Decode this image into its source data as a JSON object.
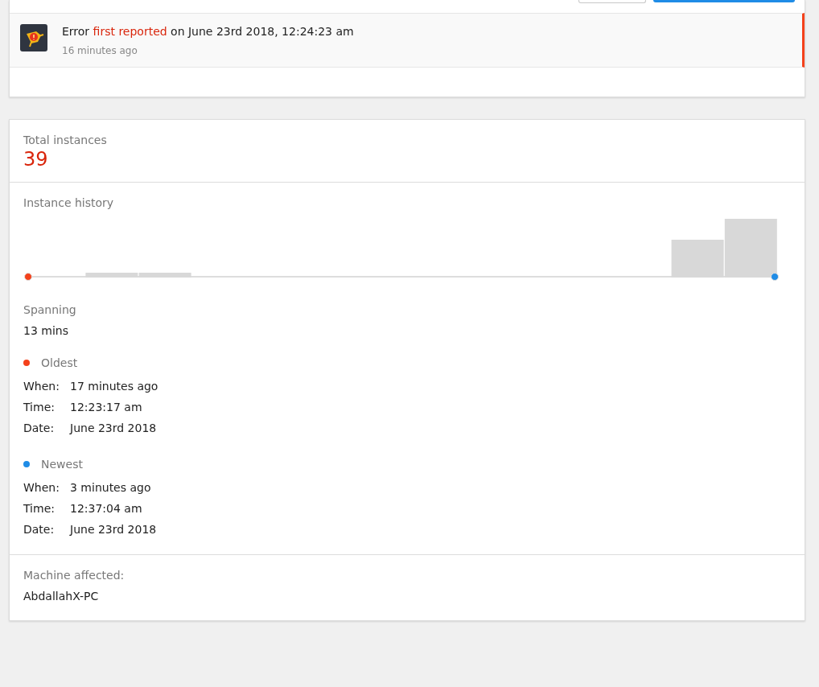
{
  "event": {
    "message_start": "Error",
    "message_highlight": "first reported",
    "message_end": "on June 23rd 2018, 12:24:23 am",
    "time_ago": "16 minutes ago"
  },
  "total": {
    "label": "Total instances",
    "value": "39"
  },
  "history": {
    "label": "Instance history"
  },
  "spanning": {
    "label": "Spanning",
    "value": "13 mins"
  },
  "endpoints": [
    {
      "title": "Oldest",
      "color": "#f4411b",
      "fields": [
        {
          "label": "When:",
          "value": "17 minutes ago"
        },
        {
          "label": "Time:",
          "value": "12:23:17 am"
        },
        {
          "label": "Date:",
          "value": "June 23rd 2018"
        }
      ]
    },
    {
      "title": "Newest",
      "color": "#1f8ce6",
      "fields": [
        {
          "label": "When:",
          "value": "3 minutes ago"
        },
        {
          "label": "Time:",
          "value": "12:37:04 am"
        },
        {
          "label": "Date:",
          "value": "June 23rd 2018"
        }
      ]
    }
  ],
  "machine": {
    "label": "Machine affected:",
    "value": "AbdallahX-PC"
  }
}
